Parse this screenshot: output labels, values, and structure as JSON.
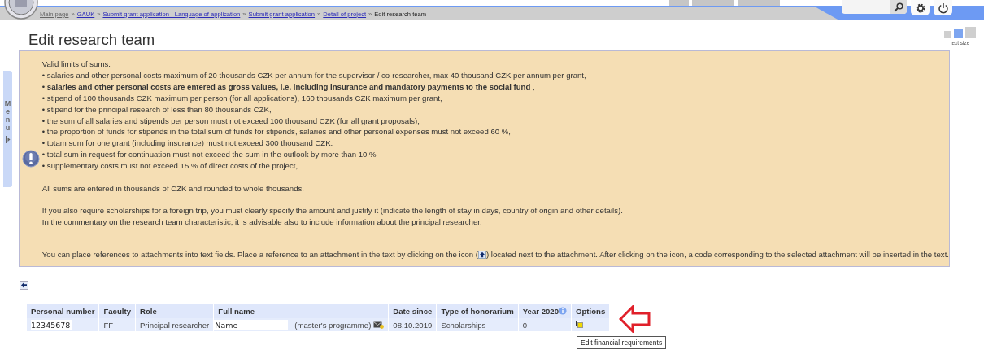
{
  "breadcrumb": [
    {
      "label": "Main page",
      "kind": "visited"
    },
    {
      "label": "GAUK",
      "kind": "link"
    },
    {
      "label": "Submit grant application - Language of application",
      "kind": "link"
    },
    {
      "label": "Submit grant application",
      "kind": "link"
    },
    {
      "label": "Detail of project",
      "kind": "link"
    },
    {
      "label": "Edit research team",
      "kind": "current"
    }
  ],
  "separator": "»",
  "side_menu": {
    "label": "Menu"
  },
  "text_size": {
    "label": "text size",
    "sizes": [
      {
        "selected": false
      },
      {
        "selected": true
      },
      {
        "selected": false
      }
    ]
  },
  "title": "Edit research team",
  "notice": {
    "paragraphs": [
      {
        "kind": "lines",
        "lines": [
          "Valid limits of sums:",
          "• salaries and other personal costs maximum of 20 thousands CZK per annum for the supervisor / co-researcher, max 40 thousand CZK per annum per grant,",
          "• **salaries and other personal costs are entered as gross values, i.e. including insurance and mandatory payments to the social fund** ,",
          "• stipend of 100 thousands CZK maximum per person (for all applications), 160 thousands CZK maximum per grant,",
          "• stipend for the principal research of less than 80 thousands CZK,",
          "• the sum of all salaries and stipends per person must not exceed 100 thousand CZK (for all grant proposals),",
          "• the proportion of funds for stipends in the total sum of funds for stipends, salaries and other personal expenses must not exceed 60 %,",
          "• totam sum for one grant (including insurance) must not exceed 300 thousand CZK.",
          "• total sum in request for continuation must not exceed the sum in the outlook by more than 10 %",
          "• supplementary costs must not exceed 15 % of direct costs of the project,"
        ]
      },
      {
        "kind": "lines",
        "lines": [
          "All sums are entered in thousands of CZK and rounded to whole thousands."
        ]
      },
      {
        "kind": "lines",
        "lines": [
          "If you also require scholarships for a foreign trip, you must clearly specify the amount and justify it (indicate the length of stay in days, country of origin and other details).",
          "In the commentary on the research team characteristic, it is advisable also to include information about the principal researcher."
        ]
      },
      {
        "kind": "icon_text",
        "before": "You can place references to attachments into text fields. Place a reference to an attachment in the text by clicking on the icon (",
        "after": ") located next to the attachment. After clicking on the icon, a code corresponding to the selected attachment will be inserted in the text."
      }
    ]
  },
  "table": {
    "columns": [
      {
        "label": "Personal number"
      },
      {
        "label": "Faculty"
      },
      {
        "label": "Role"
      },
      {
        "label": "Full name"
      },
      {
        "label": "Date since"
      },
      {
        "label": "Type of honorarium"
      },
      {
        "label": "Year 2020",
        "info": true
      },
      {
        "label": "Options"
      }
    ],
    "rows": [
      {
        "personal_number": "12345678",
        "faculty": "FF",
        "role": "Principal researcher",
        "name": "Name",
        "programme": "(master's programme)",
        "date_since": "08.10.2019",
        "honorarium": "Scholarships",
        "year_value": "0"
      }
    ]
  },
  "tooltip": "Edit financial requirements"
}
